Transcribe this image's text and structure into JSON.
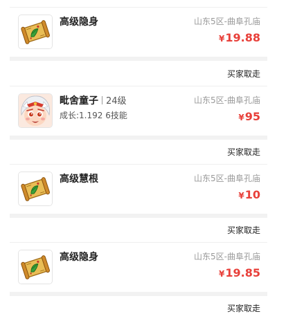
{
  "listings": [
    {
      "item_name": "高级隐身",
      "thumb_icon": "scroll-icon",
      "server": "山东5区-曲阜孔庙",
      "currency": "¥",
      "price": "19.88",
      "footer_label": "买家取走"
    },
    {
      "item_name": "毗舍童子",
      "level": "24级",
      "growth": "成长:1.192 6技能",
      "thumb_icon": "child-pet-avatar-icon",
      "server": "山东5区-曲阜孔庙",
      "currency": "¥",
      "price": "95",
      "footer_label": "买家取走"
    },
    {
      "item_name": "高级慧根",
      "thumb_icon": "scroll-icon",
      "server": "山东5区-曲阜孔庙",
      "currency": "¥",
      "price": "10",
      "footer_label": "买家取走"
    },
    {
      "item_name": "高级隐身",
      "thumb_icon": "scroll-icon",
      "server": "山东5区-曲阜孔庙",
      "currency": "¥",
      "price": "19.85",
      "footer_label": "买家取走"
    }
  ],
  "colors": {
    "price": "#e8403a",
    "muted": "#999999",
    "separator": "#f2f2f2"
  }
}
